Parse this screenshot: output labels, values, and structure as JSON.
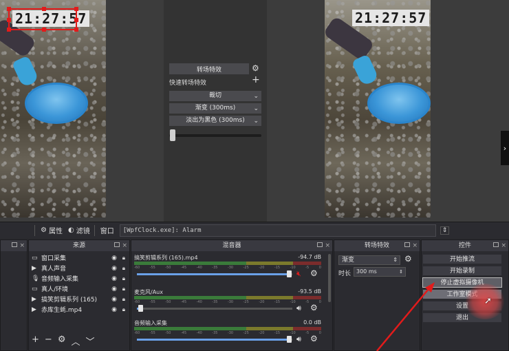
{
  "preview": {
    "left_clock": "21:27:57",
    "right_clock": "21:27:57"
  },
  "transition_panel": {
    "button_label": "转场特效",
    "quick_label": "快速转场特效",
    "items": [
      "裁切",
      "渐变 (300ms)",
      "淡出为黑色 (300ms)"
    ]
  },
  "source_toolbar": {
    "properties": "属性",
    "filters": "滤镜",
    "window_label": "窗口",
    "window_value": "[WpfClock.exe]: Alarm"
  },
  "sources": {
    "title": "来源",
    "items": [
      {
        "label": "窗口采集",
        "icon": "window-icon"
      },
      {
        "label": "真人声音",
        "icon": "play-icon"
      },
      {
        "label": "音频输入采集",
        "icon": "mic-icon"
      },
      {
        "label": "真人/环境",
        "icon": "window-icon"
      },
      {
        "label": "搞笑剪辑系列 (165)",
        "icon": "play-icon"
      },
      {
        "label": "赤库生蚝.mp4",
        "icon": "play-icon"
      }
    ]
  },
  "mixer": {
    "title": "混音器",
    "channels": [
      {
        "name": "搞笑剪辑系列 (165).mp4",
        "db": "-94.7 dB",
        "level": 0.0,
        "volume": 0.98,
        "muted": true
      },
      {
        "name": "麦克风/Aux",
        "db": "-93.5 dB",
        "level": 0.0,
        "volume": 0.02,
        "muted": false
      },
      {
        "name": "音频输入采集",
        "db": "0.0 dB",
        "level": 0.0,
        "volume": 0.98,
        "muted": false
      }
    ]
  },
  "scene_transitions": {
    "title": "转场特效",
    "selected": "渐变",
    "duration_label": "时长",
    "duration_value": "300 ms"
  },
  "controls": {
    "title": "控件",
    "buttons": [
      "开始推流",
      "开始录制",
      "停止虚拟摄像机",
      "工作室模式",
      "设置",
      "退出"
    ]
  },
  "colors": {
    "accent_red": "#e21b1b",
    "volume_blue": "#6aa0e8"
  }
}
